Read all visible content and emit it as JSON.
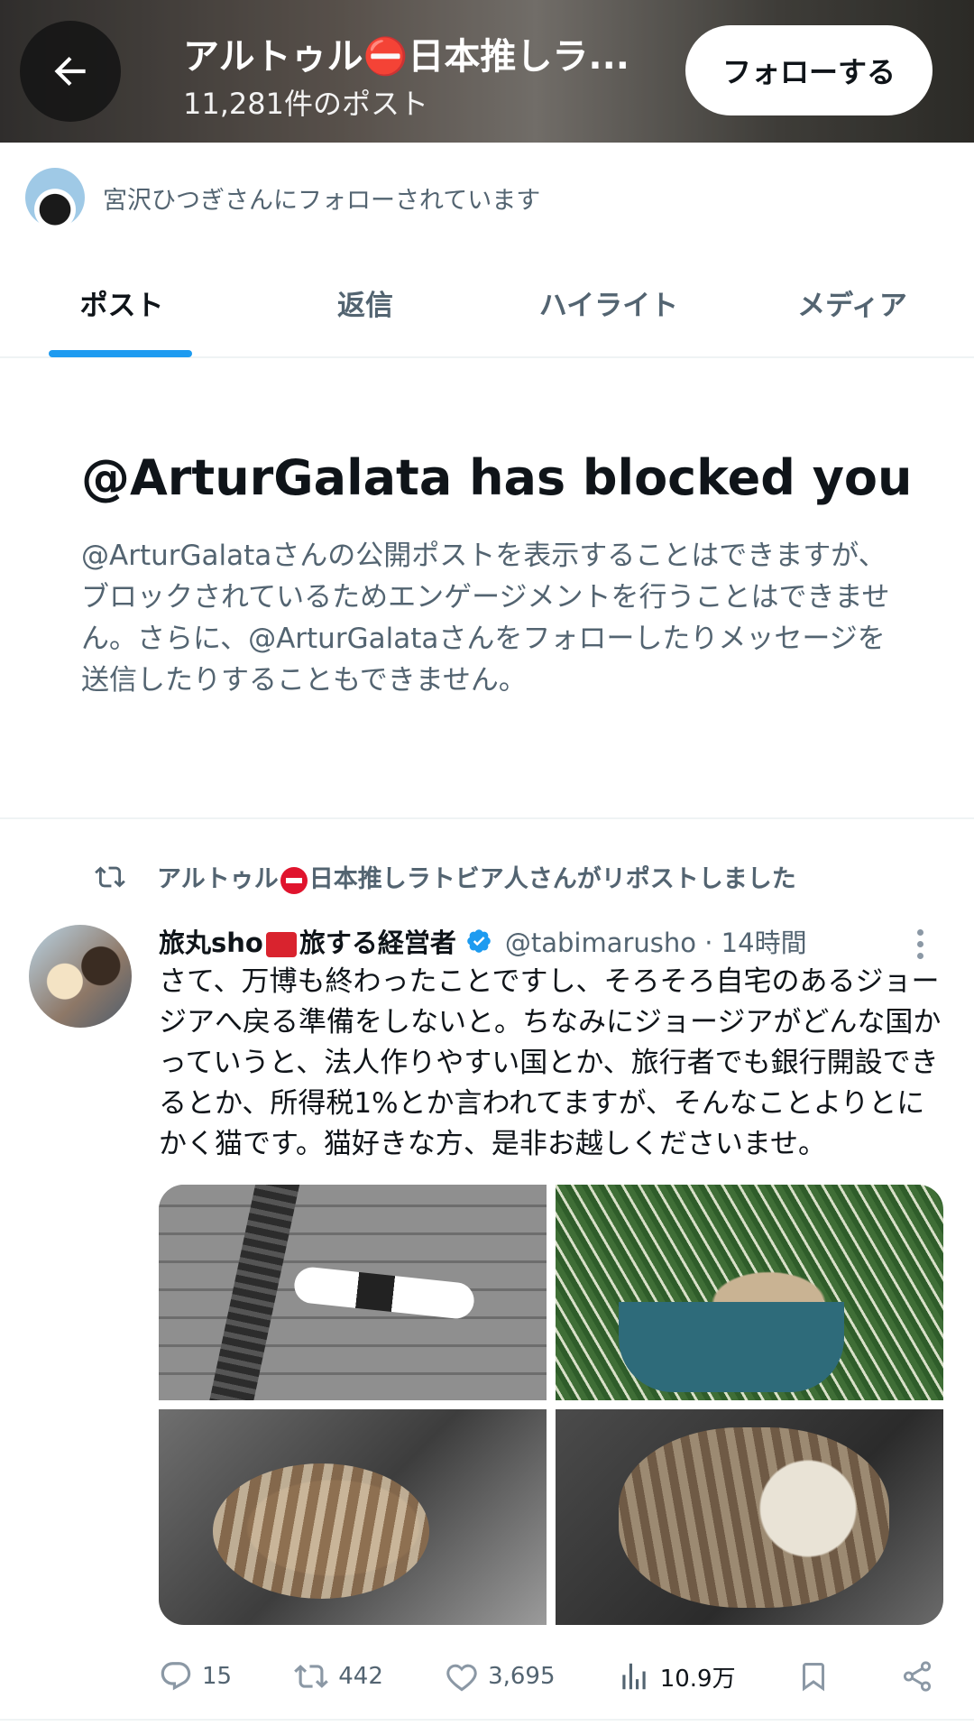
{
  "header": {
    "title": "アルトゥル⛔日本推しラ...",
    "post_count": "11,281件のポスト",
    "follow_label": "フォローする"
  },
  "followed_by": {
    "text": "宮沢ひつぎさんにフォローされています"
  },
  "tabs": [
    {
      "label": "ポスト",
      "active": true
    },
    {
      "label": "返信",
      "active": false
    },
    {
      "label": "ハイライト",
      "active": false
    },
    {
      "label": "メディア",
      "active": false
    }
  ],
  "blocked": {
    "title": "@ArturGalata has blocked you",
    "description": "@ArturGalataさんの公開ポストを表示することはできますが、ブロックされているためエンゲージメントを行うことはできません。さらに、@ArturGalataさんをフォローしたりメッセージを送信したりすることもできません。"
  },
  "repost": {
    "name_prefix": "アルトゥル",
    "text": "日本推しラトビア人さんがリポストしました"
  },
  "tweet": {
    "name_part1": "旅丸sho",
    "name_part2": "旅する経営者",
    "handle_time": "@tabimarusho · 14時間",
    "text": "さて、万博も終わったことですし、そろそろ自宅のあるジョージアへ戻る準備をしないと。ちなみにジョージアがどんな国かっていうと、法人作りやすい国とか、旅行者でも銀行開設できるとか、所得税1%とか言われてますが、そんなことよりとにかく猫です。猫好きな方、是非お越しくださいませ。",
    "replies": "15",
    "reposts": "442",
    "likes": "3,695",
    "views": "10.9万"
  },
  "colors": {
    "accent": "#1d9bf0",
    "secondary_text": "#536471",
    "stop_red": "#e0142d"
  }
}
